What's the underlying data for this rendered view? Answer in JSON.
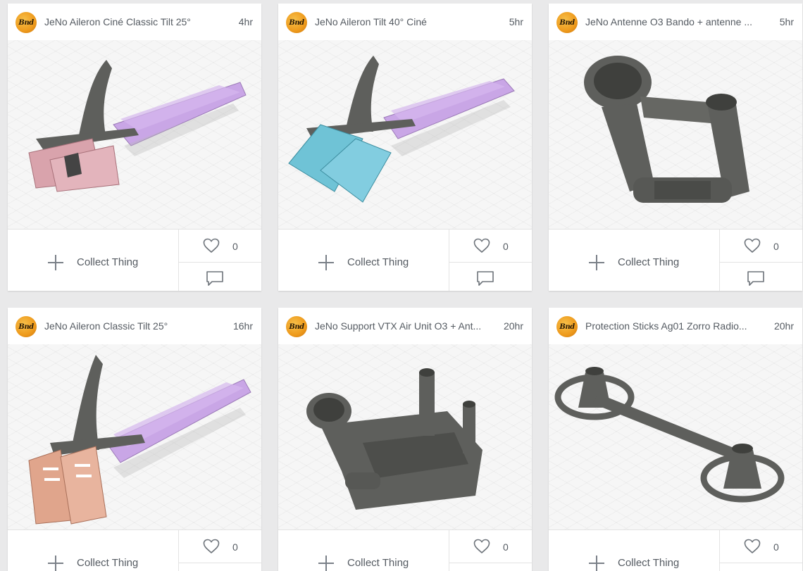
{
  "cards": [
    {
      "title": "JeNo Aileron Ciné Classic Tilt 25°",
      "time": "4hr",
      "likes": "0",
      "collect_label": "Collect Thing",
      "avatar_text": "Bnd",
      "object": "arm-pink"
    },
    {
      "title": "JeNo Aileron Tilt 40° Ciné",
      "time": "5hr",
      "likes": "0",
      "collect_label": "Collect Thing",
      "avatar_text": "Bnd",
      "object": "arm-blue"
    },
    {
      "title": "JeNo Antenne O3 Bando + antenne ...",
      "time": "5hr",
      "likes": "0",
      "collect_label": "Collect Thing",
      "avatar_text": "Bnd",
      "object": "antenna-mount"
    },
    {
      "title": "JeNo Aileron Classic Tilt 25°",
      "time": "16hr",
      "likes": "0",
      "collect_label": "Collect Thing",
      "avatar_text": "Bnd",
      "object": "arm-orange"
    },
    {
      "title": "JeNo Support VTX Air Unit O3 + Ant...",
      "time": "20hr",
      "likes": "0",
      "collect_label": "Collect Thing",
      "avatar_text": "Bnd",
      "object": "vtx-support"
    },
    {
      "title": "Protection Sticks Ag01 Zorro Radio...",
      "time": "20hr",
      "likes": "0",
      "collect_label": "Collect Thing",
      "avatar_text": "Bnd",
      "object": "stick-protector"
    }
  ],
  "colors": {
    "page_bg": "#e9e9ea",
    "card_bg": "#ffffff",
    "text": "#555b62",
    "model_grey": "#5e5f5c",
    "purple": "#c9a6e6",
    "pink": "#d9a3ac",
    "blue": "#6fc3d6",
    "orange": "#e0a58c"
  },
  "icons": {
    "collect": "plus-icon",
    "like": "heart-icon",
    "comment": "comment-icon"
  }
}
